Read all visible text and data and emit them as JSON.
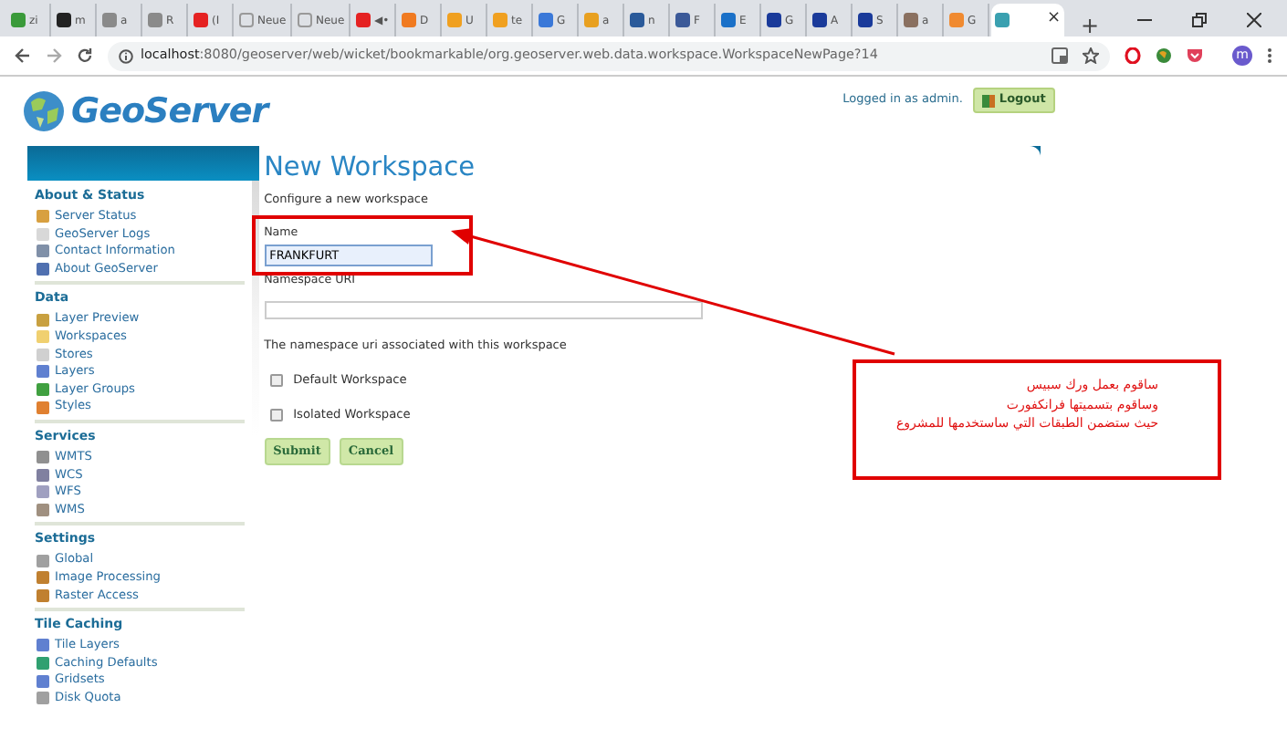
{
  "browser": {
    "tabs": [
      {
        "label": "zi",
        "color": "#3a9a3a",
        "selected": false
      },
      {
        "label": "m",
        "color": "#222222",
        "selected": false
      },
      {
        "label": "a",
        "color": "#8a8a8a",
        "selected": false
      },
      {
        "label": "R",
        "color": "#8a8a8a",
        "selected": false
      },
      {
        "label": "(I",
        "color": "#e52222",
        "selected": false
      },
      {
        "label": "Neue",
        "color": "#dee1e6",
        "selected": false
      },
      {
        "label": "Neue",
        "color": "#dee1e6",
        "selected": false
      },
      {
        "label": "◀•",
        "color": "#e52222",
        "selected": false
      },
      {
        "label": "D",
        "color": "#f07a20",
        "selected": false
      },
      {
        "label": "U",
        "color": "#f0a020",
        "selected": false
      },
      {
        "label": "te",
        "color": "#f0a020",
        "selected": false
      },
      {
        "label": "G",
        "color": "#3a78d8",
        "selected": false
      },
      {
        "label": "a",
        "color": "#e8a020",
        "selected": false
      },
      {
        "label": "n",
        "color": "#2a5a9a",
        "selected": false
      },
      {
        "label": "F",
        "color": "#3b5998",
        "selected": false
      },
      {
        "label": "E",
        "color": "#1a70c8",
        "selected": false
      },
      {
        "label": "G",
        "color": "#1a3a9a",
        "selected": false
      },
      {
        "label": "A",
        "color": "#1a3a9a",
        "selected": false
      },
      {
        "label": "S",
        "color": "#1a3a9a",
        "selected": false
      },
      {
        "label": "a",
        "color": "#8a7060",
        "selected": false
      },
      {
        "label": "G",
        "color": "#f08a30",
        "selected": false
      },
      {
        "close": "×",
        "color": "#3aa0b0",
        "selected": true
      }
    ],
    "new_tab": "+",
    "url_host": "localhost",
    "url_rest": ":8080/geoserver/web/wicket/bookmarkable/org.geoserver.web.data.workspace.WorkspaceNewPage?14",
    "profile_initial": "m"
  },
  "header": {
    "logo": "GeoServer",
    "logged_in": "Logged in as admin.",
    "logout": "Logout"
  },
  "sidebar": [
    {
      "title": "About & Status",
      "items": [
        {
          "label": "Server Status",
          "color": "#d8a040"
        },
        {
          "label": "GeoServer Logs",
          "color": "#d8d8d8"
        },
        {
          "label": "Contact Information",
          "color": "#8090a8"
        },
        {
          "label": "About GeoServer",
          "color": "#5070b0"
        }
      ]
    },
    {
      "title": "Data",
      "items": [
        {
          "label": "Layer Preview",
          "color": "#c8a040"
        },
        {
          "label": "Workspaces",
          "color": "#f0d070"
        },
        {
          "label": "Stores",
          "color": "#d0d0d0"
        },
        {
          "label": "Layers",
          "color": "#6080d0"
        },
        {
          "label": "Layer Groups",
          "color": "#40a040"
        },
        {
          "label": "Styles",
          "color": "#e08030"
        }
      ]
    },
    {
      "title": "Services",
      "items": [
        {
          "label": "WMTS",
          "color": "#909090"
        },
        {
          "label": "WCS",
          "color": "#8080a0"
        },
        {
          "label": "WFS",
          "color": "#a0a0c0"
        },
        {
          "label": "WMS",
          "color": "#a09080"
        }
      ]
    },
    {
      "title": "Settings",
      "items": [
        {
          "label": "Global",
          "color": "#a0a0a0"
        },
        {
          "label": "Image Processing",
          "color": "#c08030"
        },
        {
          "label": "Raster Access",
          "color": "#c08030"
        }
      ]
    },
    {
      "title": "Tile Caching",
      "items": [
        {
          "label": "Tile Layers",
          "color": "#6080d0"
        },
        {
          "label": "Caching Defaults",
          "color": "#30a070"
        },
        {
          "label": "Gridsets",
          "color": "#6080d0"
        },
        {
          "label": "Disk Quota",
          "color": "#a0a0a0"
        }
      ]
    }
  ],
  "form": {
    "title": "New Workspace",
    "subtitle": "Configure a new workspace",
    "name_label": "Name",
    "name_value": "FRANKFURT",
    "uri_label": "Namespace URI",
    "uri_help": "The namespace uri associated with this workspace",
    "checkboxes": [
      {
        "label": "Default Workspace",
        "checked": false
      },
      {
        "label": "Isolated Workspace",
        "checked": false
      }
    ],
    "buttons": [
      "Submit",
      "Cancel"
    ]
  },
  "annotation": {
    "lines": [
      "ساقوم   بعمل ورك سبيس",
      "وساقوم    بتسميتها فرانكفورت",
      "حيث  ستضمن الطبقات التي ساستخدمها للمشروع"
    ]
  }
}
